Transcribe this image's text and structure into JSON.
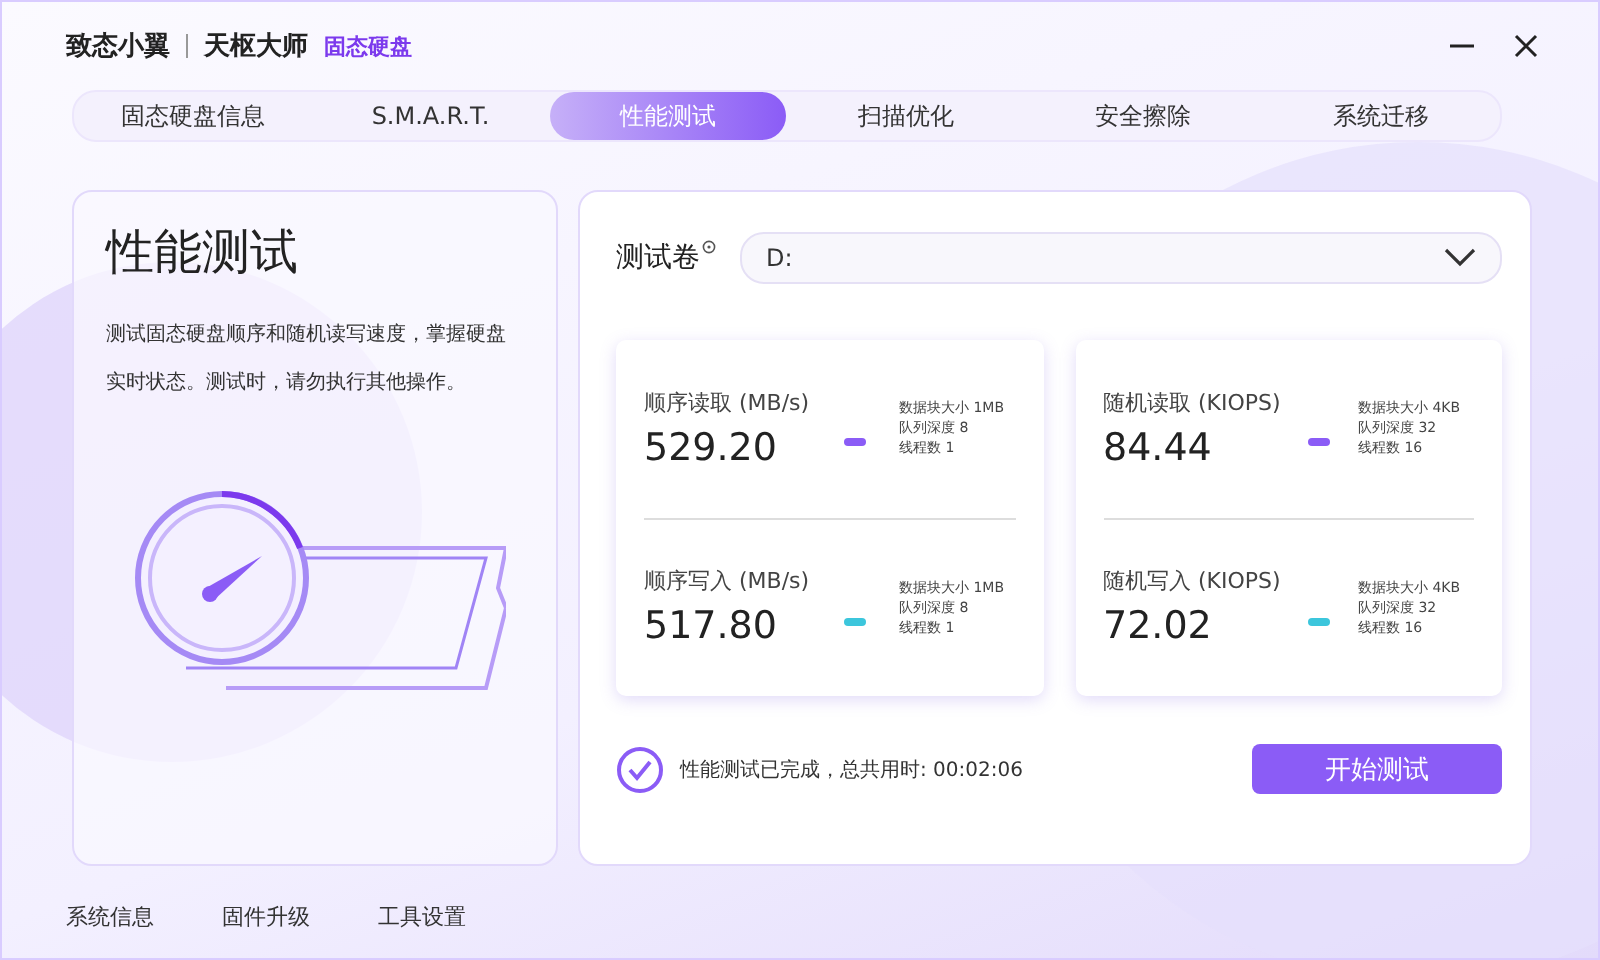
{
  "window": {
    "brand": "致态小翼",
    "product": "天枢大师",
    "product_tag": "固态硬盘"
  },
  "tabs": [
    {
      "label": "固态硬盘信息",
      "selected": false
    },
    {
      "label": "S.M.A.R.T.",
      "selected": false
    },
    {
      "label": "性能测试",
      "selected": true
    },
    {
      "label": "扫描优化",
      "selected": false
    },
    {
      "label": "安全擦除",
      "selected": false
    },
    {
      "label": "系统迁移",
      "selected": false
    }
  ],
  "intro": {
    "title": "性能测试",
    "description": "测试固态硬盘顺序和随机读写速度，掌握硬盘实时状态。测试时，请勿执行其他操作。"
  },
  "volume": {
    "label": "测试卷",
    "value": "D:"
  },
  "result_cards": [
    [
      {
        "name": "顺序读取 (MB/s)",
        "value": "529.20",
        "color": "#8b5cf6",
        "details": [
          "数据块大小 1MB",
          "队列深度 8",
          "线程数 1"
        ]
      },
      {
        "name": "顺序写入 (MB/s)",
        "value": "517.80",
        "color": "#3cc6dc",
        "details": [
          "数据块大小 1MB",
          "队列深度 8",
          "线程数 1"
        ]
      }
    ],
    [
      {
        "name": "随机读取 (KIOPS)",
        "value": "84.44",
        "color": "#8b5cf6",
        "details": [
          "数据块大小 4KB",
          "队列深度 32",
          "线程数 16"
        ]
      },
      {
        "name": "随机写入 (KIOPS)",
        "value": "72.02",
        "color": "#3cc6dc",
        "details": [
          "数据块大小 4KB",
          "队列深度 32",
          "线程数 16"
        ]
      }
    ]
  ],
  "status": {
    "completed": true,
    "text": "性能测试已完成，总共用时: 00:02:06"
  },
  "start_button": "开始测试",
  "footer": [
    "系统信息",
    "固件升级",
    "工具设置"
  ]
}
